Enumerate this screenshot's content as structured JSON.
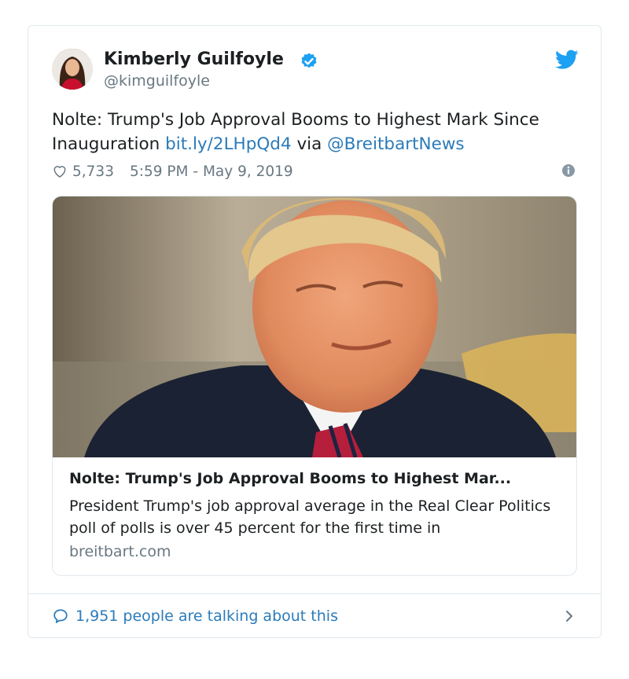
{
  "tweet": {
    "author": {
      "name": "Kimberly Guilfoyle",
      "handle": "@kimguilfoyle",
      "verified": true
    },
    "text": {
      "prefix": "Nolte: Trump's Job Approval Booms to Highest Mark Since Inauguration ",
      "link": "bit.ly/2LHpQd4",
      "via": " via ",
      "mention": "@BreitbartNews"
    },
    "likes": "5,733",
    "timestamp": "5:59 PM - May 9, 2019",
    "card": {
      "title": "Nolte: Trump's Job Approval Booms to Highest Mar...",
      "description": "President Trump's job approval average in the Real Clear Politics poll of polls is over 45 percent for the first time in",
      "domain": "breitbart.com"
    },
    "conversation": "1,951 people are talking about this"
  },
  "icons": {
    "brand": "twitter-bird-icon",
    "verified": "verified-badge-icon",
    "like": "heart-icon",
    "info": "info-icon",
    "reply": "comment-icon",
    "next": "chevron-right-icon"
  },
  "colors": {
    "link": "#2b7bb9",
    "secondary_text": "#697882",
    "verified": "#1da1f2",
    "twitter_blue": "#1da1f2",
    "border": "#e1e8ed"
  }
}
